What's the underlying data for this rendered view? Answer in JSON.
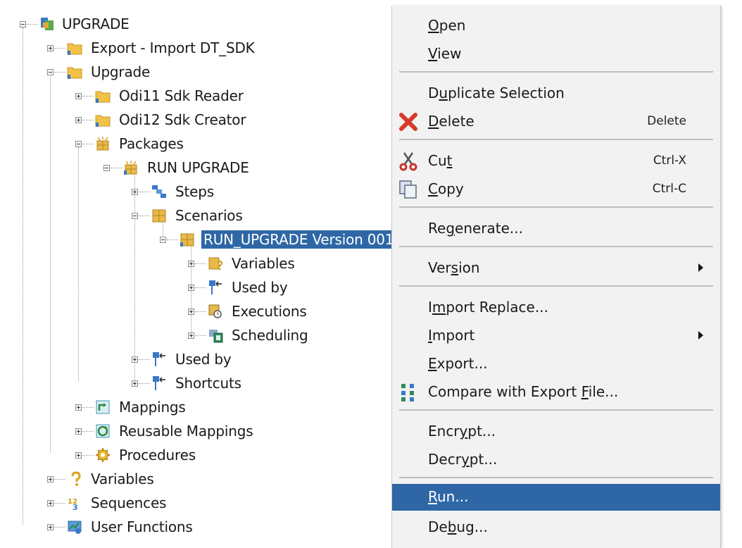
{
  "tree": {
    "nodes": [
      {
        "label": "UPGRADE",
        "icon": "project-icon"
      },
      {
        "label": "Export - Import DT_SDK",
        "icon": "folder-icon"
      },
      {
        "label": "Upgrade",
        "icon": "folder-icon"
      },
      {
        "label": "Odi11 Sdk Reader",
        "icon": "folder-icon"
      },
      {
        "label": "Odi12 Sdk Creator",
        "icon": "folder-icon"
      },
      {
        "label": "Packages",
        "icon": "packages-icon"
      },
      {
        "label": "RUN UPGRADE",
        "icon": "package-icon"
      },
      {
        "label": "Steps",
        "icon": "steps-icon"
      },
      {
        "label": "Scenarios",
        "icon": "scenarios-icon"
      },
      {
        "label": "RUN_UPGRADE Version 001",
        "icon": "scenario-icon"
      },
      {
        "label": "Variables",
        "icon": "variables-folder-icon"
      },
      {
        "label": "Used by",
        "icon": "used-by-icon"
      },
      {
        "label": "Executions",
        "icon": "executions-icon"
      },
      {
        "label": "Scheduling",
        "icon": "scheduling-icon"
      },
      {
        "label": "Used by",
        "icon": "used-by-icon"
      },
      {
        "label": "Shortcuts",
        "icon": "shortcuts-icon"
      },
      {
        "label": "Mappings",
        "icon": "mappings-icon"
      },
      {
        "label": "Reusable Mappings",
        "icon": "reusable-mappings-icon"
      },
      {
        "label": "Procedures",
        "icon": "procedures-icon"
      },
      {
        "label": "Variables",
        "icon": "variable-icon"
      },
      {
        "label": "Sequences",
        "icon": "sequences-icon"
      },
      {
        "label": "User Functions",
        "icon": "user-functions-icon"
      }
    ]
  },
  "menu": {
    "items": [
      {
        "pre": "",
        "u": "O",
        "post": "pen",
        "shortcut": ""
      },
      {
        "pre": "",
        "u": "V",
        "post": "iew",
        "shortcut": ""
      },
      {
        "pre": "D",
        "u": "u",
        "post": "plicate Selection",
        "shortcut": ""
      },
      {
        "pre": "",
        "u": "D",
        "post": "elete",
        "shortcut": "Delete",
        "icon": "delete-icon"
      },
      {
        "pre": "Cu",
        "u": "t",
        "post": "",
        "shortcut": "Ctrl-X",
        "icon": "cut-icon"
      },
      {
        "pre": "",
        "u": "C",
        "post": "opy",
        "shortcut": "Ctrl-C",
        "icon": "copy-icon"
      },
      {
        "pre": "Re",
        "u": "g",
        "post": "enerate...",
        "shortcut": ""
      },
      {
        "pre": "Ver",
        "u": "s",
        "post": "ion",
        "shortcut": "",
        "submenu": true
      },
      {
        "pre": "I",
        "u": "m",
        "post": "port Replace...",
        "shortcut": ""
      },
      {
        "pre": "",
        "u": "I",
        "post": "mport",
        "shortcut": "",
        "submenu": true
      },
      {
        "pre": "",
        "u": "E",
        "post": "xport...",
        "shortcut": ""
      },
      {
        "pre": "Compare with Export ",
        "u": "F",
        "post": "ile...",
        "shortcut": "",
        "icon": "compare-icon"
      },
      {
        "pre": "Encr",
        "u": "y",
        "post": "pt...",
        "shortcut": ""
      },
      {
        "pre": "Decr",
        "u": "y",
        "post": "pt...",
        "shortcut": ""
      },
      {
        "pre": "",
        "u": "R",
        "post": "un...",
        "shortcut": "",
        "highlighted": true
      },
      {
        "pre": "De",
        "u": "b",
        "post": "ug...",
        "shortcut": ""
      }
    ]
  },
  "colors": {
    "selection": "#2f67a6",
    "menu_bg": "#f2f2f2"
  }
}
